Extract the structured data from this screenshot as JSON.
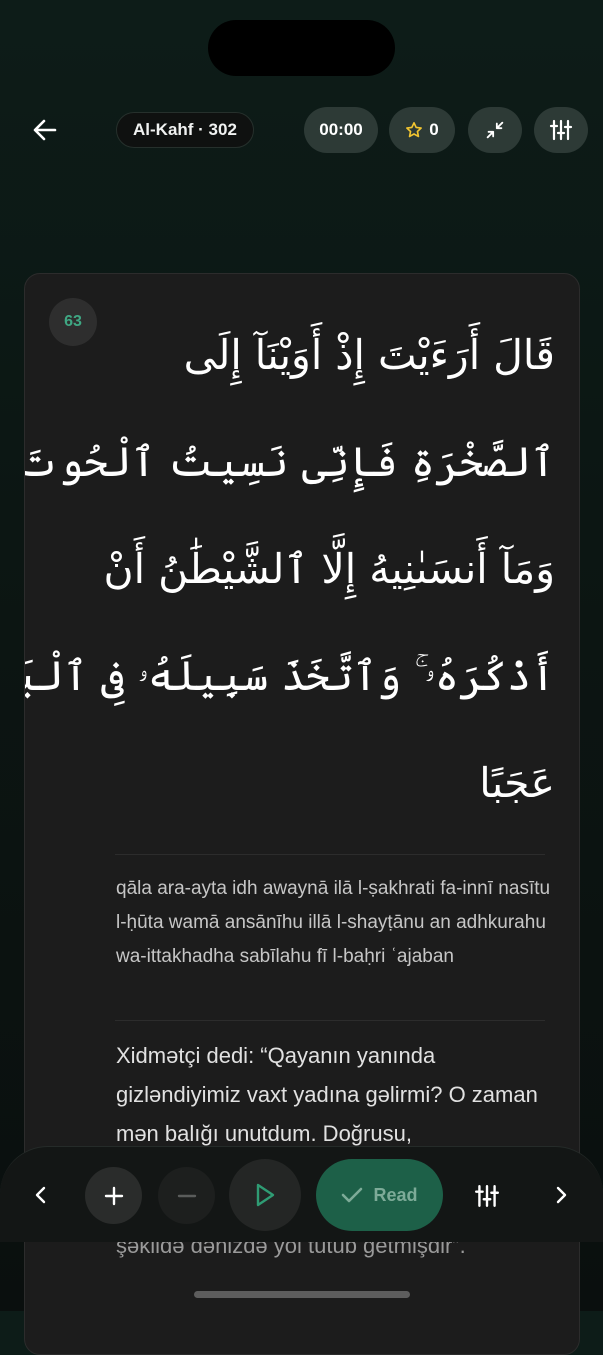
{
  "header": {
    "title": "Al-Kahf · 302",
    "timer": "00:00",
    "stars": "0"
  },
  "verse": {
    "number": "63",
    "arabic_lines": [
      "قَالَ أَرَءَيْتَ إِذْ أَوَيْنَآ إِلَى",
      "ٱلصَّخْرَةِ فَإِنِّى نَسِيتُ ٱلْحُوتَ",
      "وَمَآ أَنسَىٰنِيهُ إِلَّا ٱلشَّيْطَٰنُ أَنْ",
      "أَذْكُرَهُۥ ۚ وَٱتَّخَذَ سَبِيلَهُۥ فِى ٱلْبَحْرِ",
      "عَجَبًا"
    ],
    "transliteration": "qāla ara-ayta idh awaynā ilā l-ṣakhrati fa-innī nasītu l-ḥūta wamā ansānīhu illā l-shayṭānu an adhkurahu wa-ittakhadha sabīlahu fī l-baḥri ʿajaban",
    "translation": "Xidmətçi dedi: “Qayanın yanında gizləndiyimiz vaxt yadına gəlirmi? O zaman mən balığı unutdum. Doğrusu,",
    "translation_tail": "şəkildə dənizdə yol tutub getmişdir”."
  },
  "controls": {
    "read_label": "Read"
  },
  "colors": {
    "accent": "#1d6048",
    "verse_number": "#3fa783"
  }
}
